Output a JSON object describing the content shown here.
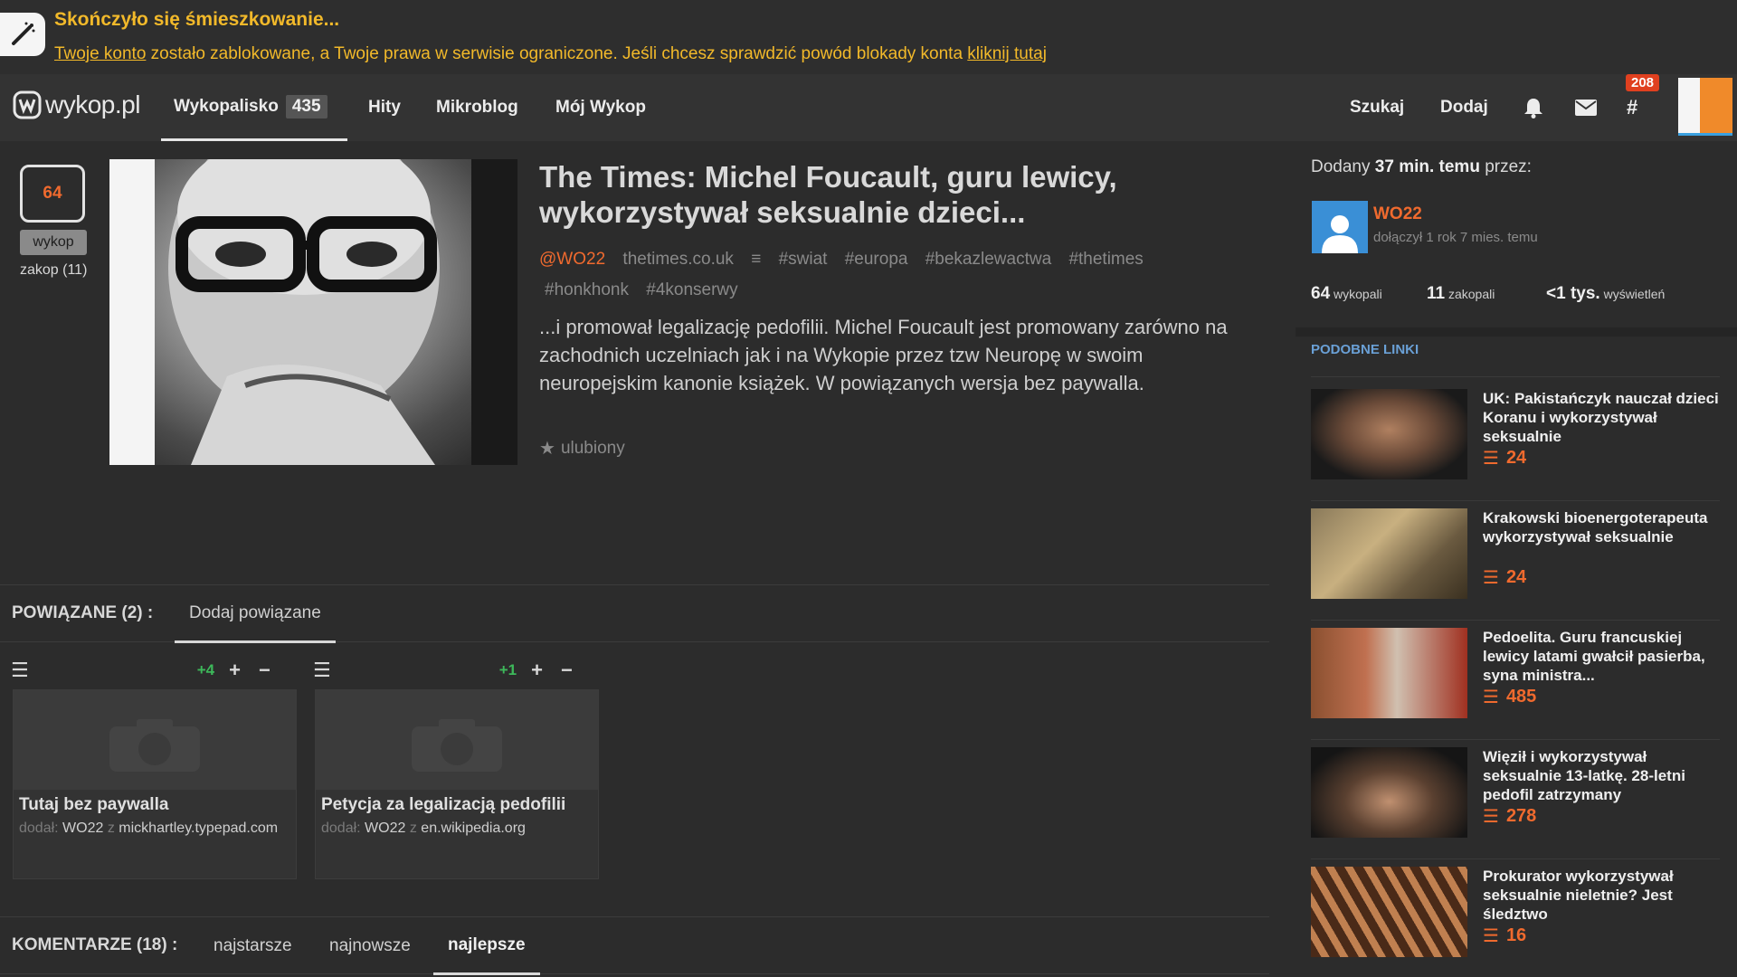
{
  "banner": {
    "title": "Skończyło się śmieszkowanie...",
    "link_account": "Twoje konto",
    "text_mid": " zostało zablokowane, a Twoje prawa w serwisie ograniczone. Jeśli chcesz sprawdzić powód blokady konta ",
    "link_click": "kliknij tutaj"
  },
  "nav": {
    "logo": "wykop.pl",
    "items": [
      {
        "label": "Wykopalisko",
        "count": "435"
      },
      {
        "label": "Hity"
      },
      {
        "label": "Mikroblog"
      },
      {
        "label": "Mój Wykop"
      }
    ],
    "search": "Szukaj",
    "add": "Dodaj",
    "tag_badge": "208"
  },
  "article": {
    "votes": "64",
    "wykop_label": "wykop",
    "zakop_label": "zakop (11)",
    "title": "The Times: Michel Foucault, guru lewicy, wykorzystywał seksualnie dzieci...",
    "author": "@WO22",
    "domain": "thetimes.co.uk",
    "tags": [
      "#swiat",
      "#europa",
      "#bekazlewactwa",
      "#thetimes",
      "#honkhonk",
      "#4konserwy"
    ],
    "description": "...i promował legalizację pedofilii. Michel Foucault jest promowany zarówno na zachodnich uczelniach jak i na Wykopie przez tzw Neuropę w swoim neuropejskim kanonie książek. W powiązanych wersja bez paywalla.",
    "favorite_label": "ulubiony"
  },
  "related": {
    "title": "POWIĄZANE (2) :",
    "add_tab": "Dodaj powiązane",
    "items": [
      {
        "count": "+4",
        "title": "Tutaj bez paywalla",
        "added_label": "dodał:",
        "user": "WO22",
        "from": "z",
        "domain": "mickhartley.typepad.com"
      },
      {
        "count": "+1",
        "title": "Petycja za legalizacją pedofilii",
        "added_label": "dodał:",
        "user": "WO22",
        "from": "z",
        "domain": "en.wikipedia.org"
      }
    ]
  },
  "comments": {
    "title": "KOMENTARZE (18) :",
    "tabs": [
      "najstarsze",
      "najnowsze",
      "najlepsze"
    ]
  },
  "sidebar": {
    "added_prefix": "Dodany",
    "added_time": "37 min. temu",
    "added_suffix": "przez:",
    "user": "WO22",
    "joined": "dołączył 1 rok 7 mies. temu",
    "stats": [
      {
        "value": "64",
        "label": "wykopali"
      },
      {
        "value": "11",
        "label": "zakopali"
      },
      {
        "value": "<1 tys.",
        "label": "wyświetleń"
      }
    ],
    "similar_title": "PODOBNE LINKI",
    "similar": [
      {
        "title": "UK: Pakistańczyk nauczał dzieci Koranu i wykorzystywał seksualnie",
        "votes": "24"
      },
      {
        "title": "Krakowski bioenergoterapeuta wykorzystywał seksualnie",
        "votes": "24"
      },
      {
        "title": "Pedoelita. Guru francuskiej lewicy latami gwałcił pasierba, syna ministra...",
        "votes": "485"
      },
      {
        "title": "Więził i wykorzystywał seksualnie 13-latkę. 28-letni pedofil zatrzymany",
        "votes": "278"
      },
      {
        "title": "Prokurator wykorzystywał seksualnie nieletnie? Jest śledztwo",
        "votes": "16"
      }
    ]
  },
  "colors": {
    "accent": "#f06a2e",
    "banner": "#f2b92a",
    "link_blue": "#6aa0d6",
    "positive": "#3db85a"
  }
}
